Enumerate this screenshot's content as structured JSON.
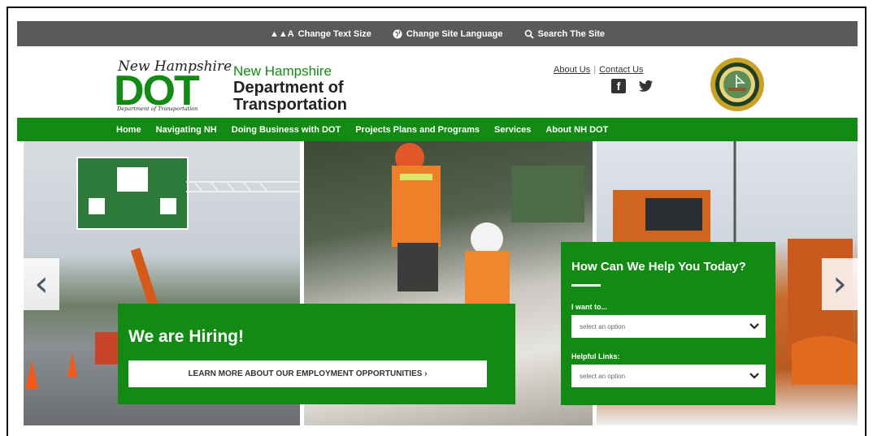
{
  "utility_bar": {
    "text_size_glyphs": "▲▲A",
    "text_size_label": "Change Text Size",
    "language_label": "Change Site Language",
    "search_label": "Search The Site"
  },
  "header": {
    "logo_script": "New Hampshire",
    "logo_letters": "DOT",
    "logo_subtitle": "Department of Transportation",
    "agency_line1": "New Hampshire",
    "agency_line2": "Department of",
    "agency_line3": "Transportation",
    "about_us": "About Us",
    "link_separator": "|",
    "contact_us": "Contact Us",
    "facebook_glyph": "f",
    "twitter_glyph": "🐦"
  },
  "nav": {
    "items": [
      "Home",
      "Navigating NH",
      "Doing Business with DOT",
      "Projects Plans and Programs",
      "Services",
      "About NH DOT"
    ]
  },
  "carousel": {
    "prev_glyph": "‹",
    "next_glyph": "›"
  },
  "hiring": {
    "title": "We are Hiring!",
    "button_label": "LEARN MORE ABOUT OUR EMPLOYMENT OPPORTUNITIES ›"
  },
  "help": {
    "title": "How Can We Help You Today?",
    "want_label": "I want to...",
    "want_value": "select an option",
    "links_label": "Helpful Links:",
    "links_value": "select an option"
  },
  "colors": {
    "brand_green": "#138a13",
    "utility_gray": "#5a5a5a"
  },
  "icons": {
    "language": "globe-icon",
    "search": "magnifier-icon",
    "chevron": "chevron-down-icon"
  }
}
